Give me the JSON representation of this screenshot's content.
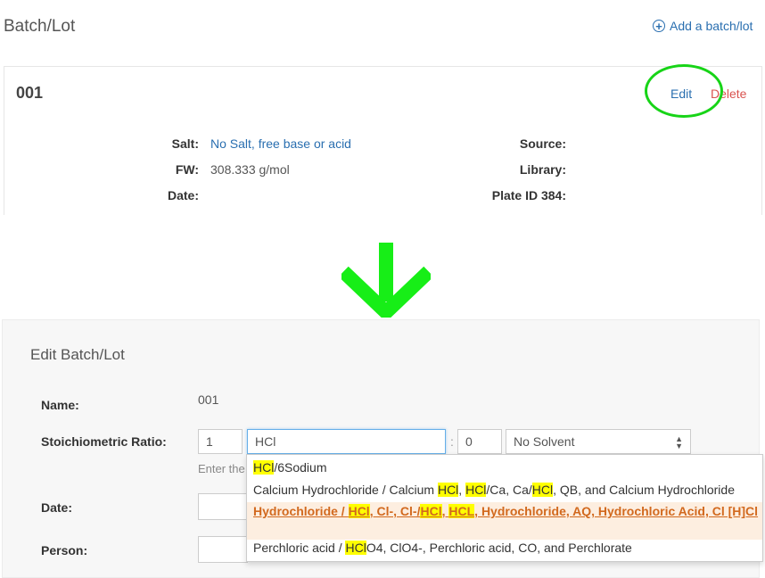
{
  "header": {
    "title": "Batch/Lot",
    "add_label": "Add a batch/lot"
  },
  "card": {
    "id": "001",
    "edit_label": "Edit",
    "delete_label": "Delete",
    "fields_left": [
      {
        "label": "Salt:",
        "value": "No Salt, free base or acid",
        "link": true
      },
      {
        "label": "FW:",
        "value": "308.333 g/mol",
        "link": false
      },
      {
        "label": "Date:",
        "value": "",
        "link": false
      }
    ],
    "fields_right": [
      {
        "label": "Source:",
        "value": ""
      },
      {
        "label": "Library:",
        "value": ""
      },
      {
        "label": "Plate ID 384:",
        "value": ""
      }
    ]
  },
  "edit_form": {
    "title": "Edit Batch/Lot",
    "name_label": "Name:",
    "name_value": "001",
    "ratio_label": "Stoichiometric Ratio:",
    "ratio_count": "1",
    "ratio_search": "HCl",
    "ratio_separator": ":",
    "ratio_second": "0",
    "solvent_value": "No Solvent",
    "hint_text": "Enter the",
    "date_label": "Date:",
    "person_label": "Person:"
  },
  "dropdown": {
    "items": [
      "HCl/6Sodium",
      "Calcium Hydrochloride / Calcium HCl, HCl/Ca, Ca/HCl, QB, and Calcium Hydrochloride",
      "Hydrochloride / HCl, Cl-, Cl-/HCl, HCL, Hydrochloride, AQ, Hydrochloric Acid, Cl [H]Cl",
      "Perchloric acid / HClO4, ClO4-, Perchloric acid, CO, and Perchlorate"
    ],
    "active_index": 2,
    "highlight_color": "#ffff00"
  },
  "colors": {
    "link": "#2a6fb0",
    "delete": "#d9534f",
    "annotation_green": "#17d417",
    "active_item_text": "#d2691e"
  },
  "icons": {
    "add": "plus-circle-icon",
    "arrow": "arrow-down-icon",
    "select": "select-caret-icon"
  }
}
